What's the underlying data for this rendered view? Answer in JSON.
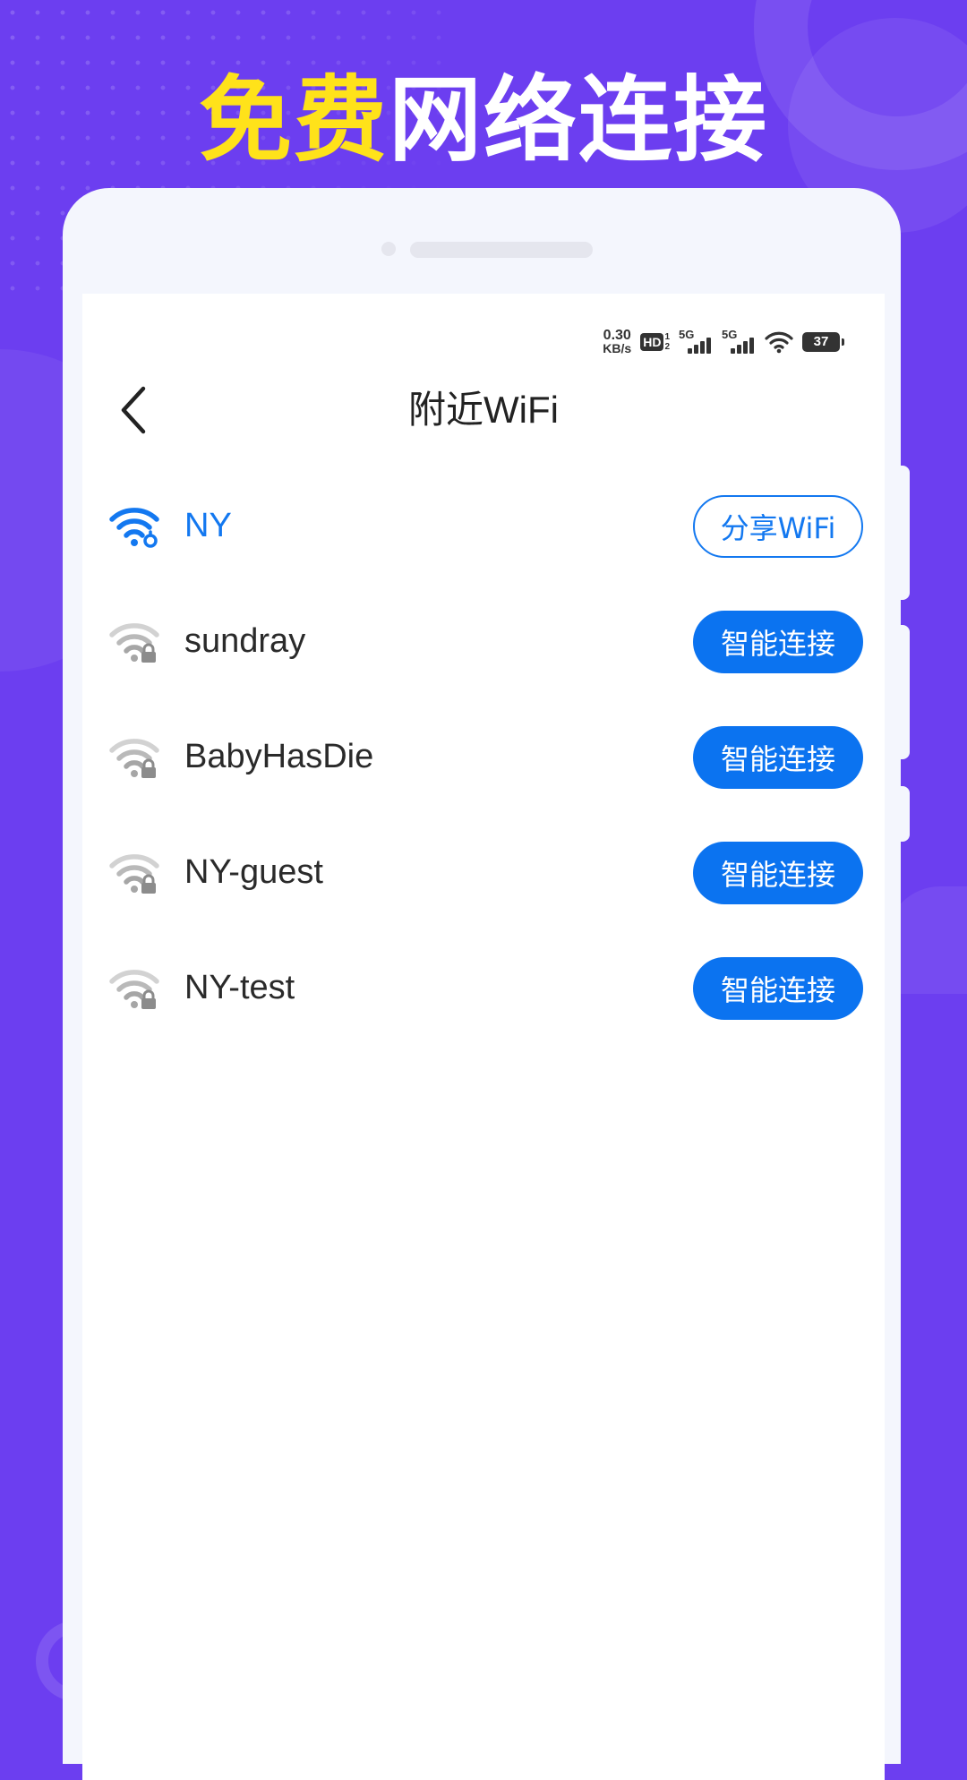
{
  "headline": {
    "highlight": "免费",
    "rest": "网络连接"
  },
  "colors": {
    "background": "#6c3ef0",
    "headline_highlight": "#ffe21a",
    "accent_blue": "#0b73f0",
    "connected_text": "#1378f0",
    "inactive_icon": "#a6a6a6"
  },
  "status_bar": {
    "speed_value": "0.30",
    "speed_unit": "KB/s",
    "hd_label": "HD",
    "hd_sim_1": "1",
    "hd_sim_2": "2",
    "net_1": "5G",
    "net_2": "5G",
    "battery": "37"
  },
  "nav": {
    "back_icon": "chevron-left-icon",
    "title": "附近WiFi"
  },
  "wifi_list": [
    {
      "name": "NY",
      "status": "connected",
      "icon": "wifi-connected-icon",
      "action": "分享WiFi"
    },
    {
      "name": "sundray",
      "status": "locked",
      "icon": "wifi-locked-icon",
      "action": "智能连接"
    },
    {
      "name": "BabyHasDie",
      "status": "locked",
      "icon": "wifi-locked-icon",
      "action": "智能连接"
    },
    {
      "name": "NY-guest",
      "status": "locked",
      "icon": "wifi-locked-icon",
      "action": "智能连接"
    },
    {
      "name": "NY-test",
      "status": "locked",
      "icon": "wifi-locked-icon",
      "action": "智能连接"
    }
  ]
}
